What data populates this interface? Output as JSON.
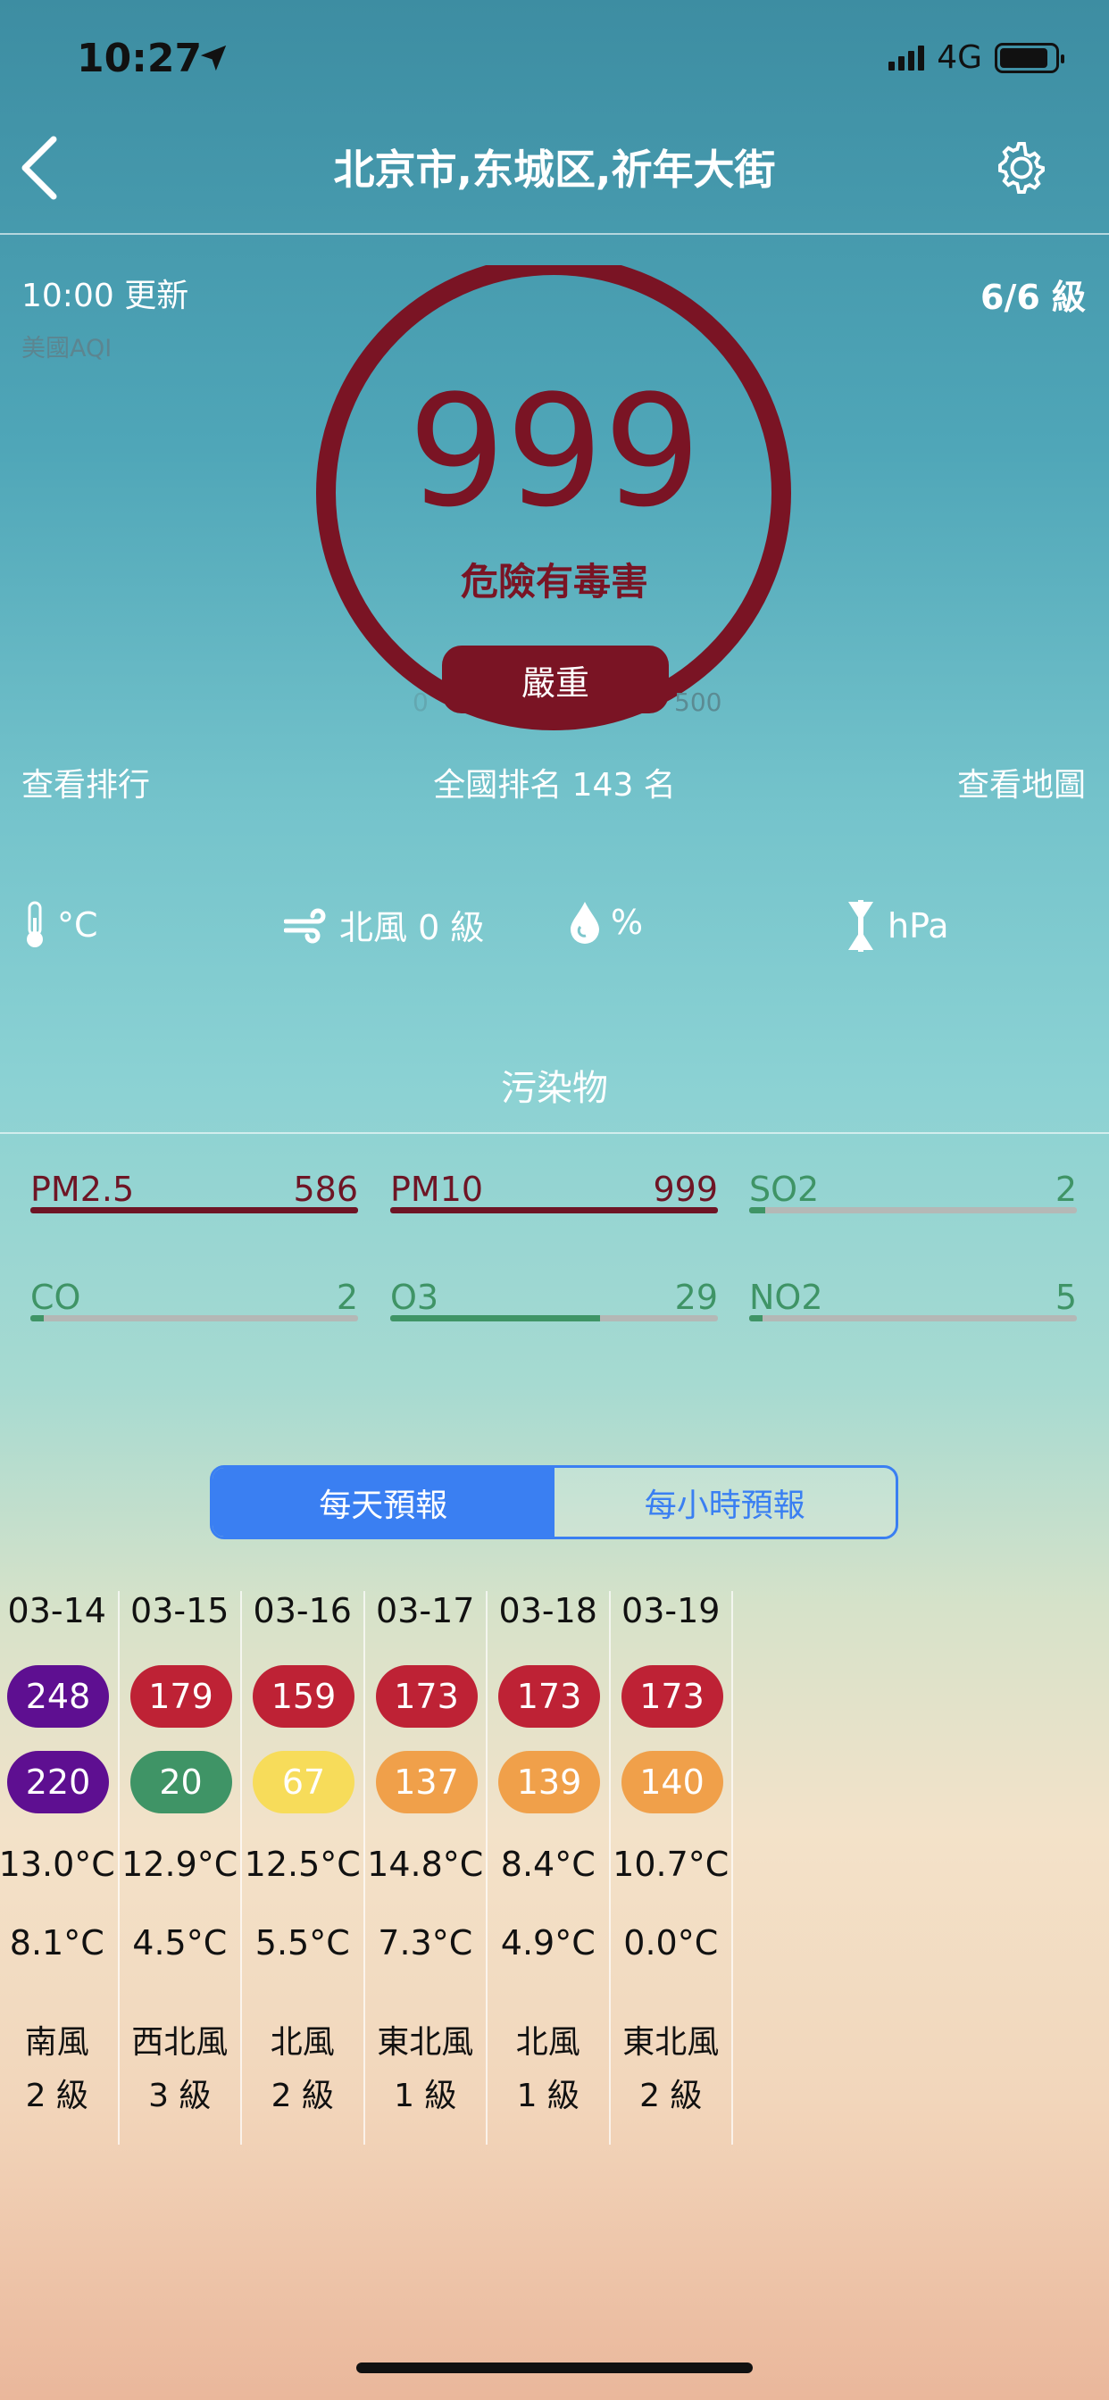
{
  "status": {
    "time": "10:27",
    "network": "4G"
  },
  "header": {
    "title": "北京市,东城区,祈年大街"
  },
  "aqi": {
    "updated": "10:00 更新",
    "standard": "美國AQI",
    "level_fraction": "6/6 級",
    "value": "999",
    "category": "危險有毒害",
    "badge": "嚴重",
    "gauge_min": "0",
    "gauge_max": "500",
    "color": "#7a1424"
  },
  "links": {
    "ranking": "查看排行",
    "national_rank": "全國排名 143 名",
    "map": "查看地圖"
  },
  "weather": {
    "temperature": "°C",
    "wind": "北風 0 級",
    "humidity": "%",
    "pressure": "hPa"
  },
  "pollutants_title": "污染物",
  "pollutants": [
    {
      "name": "PM2.5",
      "value": "586",
      "fill": 1.0,
      "color": "#6e1525"
    },
    {
      "name": "PM10",
      "value": "999",
      "fill": 1.0,
      "color": "#6e1525"
    },
    {
      "name": "SO2",
      "value": "2",
      "fill": 0.05,
      "color": "#3f9466"
    },
    {
      "name": "CO",
      "value": "2",
      "fill": 0.04,
      "color": "#3f9466"
    },
    {
      "name": "O3",
      "value": "29",
      "fill": 0.64,
      "color": "#3f9466"
    },
    {
      "name": "NO2",
      "value": "5",
      "fill": 0.04,
      "color": "#3f9466"
    }
  ],
  "forecast_tabs": {
    "daily": "每天預報",
    "hourly": "每小時預報",
    "active": "daily"
  },
  "forecast": [
    {
      "date": "03-14",
      "aqi_high": "248",
      "aqi_high_color": "#5e0f91",
      "aqi_low": "220",
      "aqi_low_color": "#5e0f91",
      "temp_high": "13.0°C",
      "temp_low": "8.1°C",
      "wind": "南風",
      "wind_level": "2 級"
    },
    {
      "date": "03-15",
      "aqi_high": "179",
      "aqi_high_color": "#be2235",
      "aqi_low": "20",
      "aqi_low_color": "#3f9466",
      "temp_high": "12.9°C",
      "temp_low": "4.5°C",
      "wind": "西北風",
      "wind_level": "3 級"
    },
    {
      "date": "03-16",
      "aqi_high": "159",
      "aqi_high_color": "#be2235",
      "aqi_low": "67",
      "aqi_low_color": "#f7dc5a",
      "temp_high": "12.5°C",
      "temp_low": "5.5°C",
      "wind": "北風",
      "wind_level": "2 級"
    },
    {
      "date": "03-17",
      "aqi_high": "173",
      "aqi_high_color": "#be2235",
      "aqi_low": "137",
      "aqi_low_color": "#f0a04a",
      "temp_high": "14.8°C",
      "temp_low": "7.3°C",
      "wind": "東北風",
      "wind_level": "1 級"
    },
    {
      "date": "03-18",
      "aqi_high": "173",
      "aqi_high_color": "#be2235",
      "aqi_low": "139",
      "aqi_low_color": "#f0a04a",
      "temp_high": "8.4°C",
      "temp_low": "4.9°C",
      "wind": "北風",
      "wind_level": "1 級"
    },
    {
      "date": "03-19",
      "aqi_high": "173",
      "aqi_high_color": "#be2235",
      "aqi_low": "140",
      "aqi_low_color": "#f0a04a",
      "temp_high": "10.7°C",
      "temp_low": "0.0°C",
      "wind": "東北風",
      "wind_level": "2 級"
    }
  ]
}
